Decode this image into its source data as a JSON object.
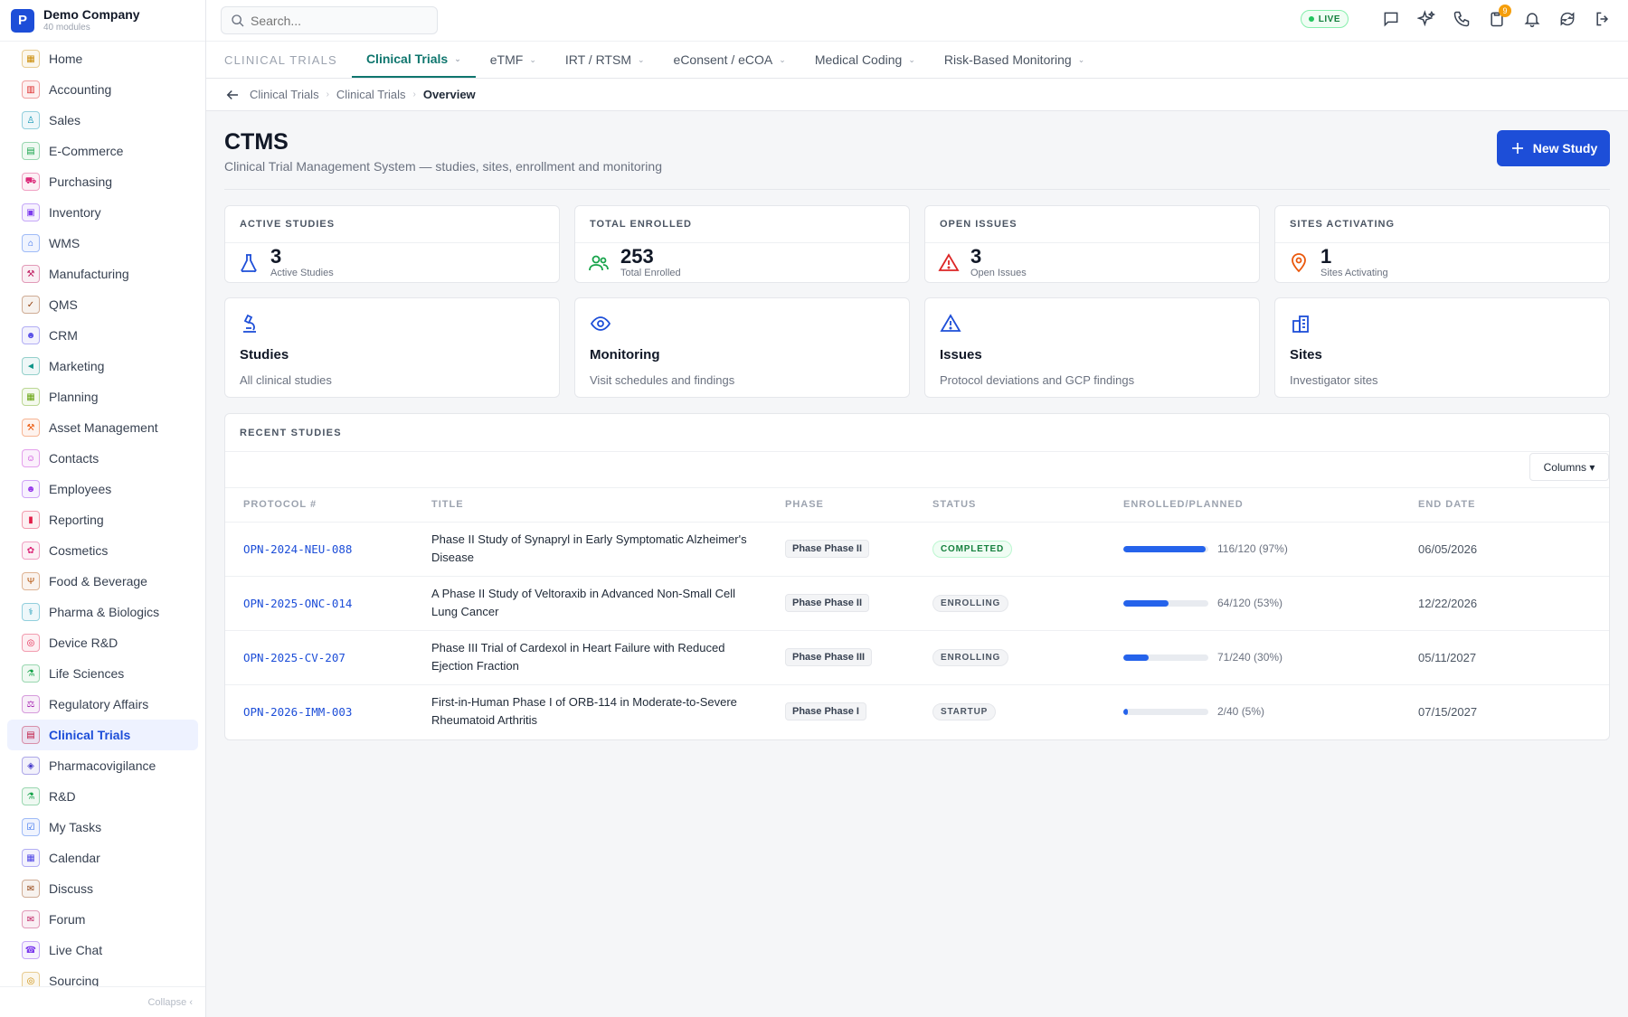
{
  "company": {
    "name": "Demo Company",
    "sub": "40 modules",
    "logo": "P"
  },
  "sidebar": {
    "items": [
      {
        "label": "Home",
        "icon": "grid-icon",
        "glyph": "▦",
        "color": "#ca8a04"
      },
      {
        "label": "Accounting",
        "icon": "bank-icon",
        "glyph": "▥",
        "color": "#dc2626"
      },
      {
        "label": "Sales",
        "icon": "flask-icon",
        "glyph": "♙",
        "color": "#0891b2"
      },
      {
        "label": "E-Commerce",
        "icon": "store-icon",
        "glyph": "▤",
        "color": "#16a34a"
      },
      {
        "label": "Purchasing",
        "icon": "cart-icon",
        "glyph": "⛟",
        "color": "#db2777"
      },
      {
        "label": "Inventory",
        "icon": "box-icon",
        "glyph": "▣",
        "color": "#7c3aed"
      },
      {
        "label": "WMS",
        "icon": "warehouse-icon",
        "glyph": "⌂",
        "color": "#2563eb"
      },
      {
        "label": "Manufacturing",
        "icon": "factory-icon",
        "glyph": "⚒",
        "color": "#be185d"
      },
      {
        "label": "QMS",
        "icon": "badge-check-icon",
        "glyph": "✓",
        "color": "#92400e"
      },
      {
        "label": "CRM",
        "icon": "users-icon",
        "glyph": "☻",
        "color": "#4f46e5"
      },
      {
        "label": "Marketing",
        "icon": "megaphone-icon",
        "glyph": "◄",
        "color": "#0d9488"
      },
      {
        "label": "Planning",
        "icon": "calendar-icon",
        "glyph": "▦",
        "color": "#65a30d"
      },
      {
        "label": "Asset Management",
        "icon": "wrench-icon",
        "glyph": "⚒",
        "color": "#ea580c"
      },
      {
        "label": "Contacts",
        "icon": "contact-icon",
        "glyph": "☺",
        "color": "#c026d3"
      },
      {
        "label": "Employees",
        "icon": "employee-icon",
        "glyph": "☻",
        "color": "#9333ea"
      },
      {
        "label": "Reporting",
        "icon": "bar-chart-icon",
        "glyph": "▮",
        "color": "#e11d48"
      },
      {
        "label": "Cosmetics",
        "icon": "flower-icon",
        "glyph": "✿",
        "color": "#db2777"
      },
      {
        "label": "Food & Beverage",
        "icon": "utensils-icon",
        "glyph": "Ψ",
        "color": "#b45309"
      },
      {
        "label": "Pharma & Biologics",
        "icon": "pill-icon",
        "glyph": "⚕",
        "color": "#0891b2"
      },
      {
        "label": "Device R&D",
        "icon": "chip-icon",
        "glyph": "◎",
        "color": "#e11d48"
      },
      {
        "label": "Life Sciences",
        "icon": "microscope-icon",
        "glyph": "⚗",
        "color": "#16a34a"
      },
      {
        "label": "Regulatory Affairs",
        "icon": "scale-icon",
        "glyph": "⚖",
        "color": "#a21caf"
      },
      {
        "label": "Clinical Trials",
        "icon": "clipboard-icon",
        "glyph": "▤",
        "color": "#be123c",
        "active": true
      },
      {
        "label": "Pharmacovigilance",
        "icon": "shield-icon",
        "glyph": "◈",
        "color": "#4338ca"
      },
      {
        "label": "R&D",
        "icon": "beaker-icon",
        "glyph": "⚗",
        "color": "#16a34a"
      },
      {
        "label": "My Tasks",
        "icon": "checklist-icon",
        "glyph": "☑",
        "color": "#2563eb"
      },
      {
        "label": "Calendar",
        "icon": "calendar-icon",
        "glyph": "▦",
        "color": "#4f46e5"
      },
      {
        "label": "Discuss",
        "icon": "chat-icon",
        "glyph": "✉",
        "color": "#92400e"
      },
      {
        "label": "Forum",
        "icon": "forum-icon",
        "glyph": "✉",
        "color": "#be185d"
      },
      {
        "label": "Live Chat",
        "icon": "headset-icon",
        "glyph": "☎",
        "color": "#7c3aed"
      },
      {
        "label": "Sourcing",
        "icon": "sourcing-icon",
        "glyph": "◎",
        "color": "#ca8a04"
      }
    ],
    "collapse_label": "Collapse ‹"
  },
  "search": {
    "placeholder": "Search..."
  },
  "topbar": {
    "live_label": "LIVE",
    "notif_count": "9"
  },
  "tabs": {
    "module_label": "CLINICAL TRIALS",
    "items": [
      {
        "label": "Clinical Trials",
        "active": true
      },
      {
        "label": "eTMF"
      },
      {
        "label": "IRT / RTSM"
      },
      {
        "label": "eConsent / eCOA"
      },
      {
        "label": "Medical Coding"
      },
      {
        "label": "Risk-Based Monitoring"
      }
    ]
  },
  "breadcrumb": {
    "items": [
      "Clinical Trials",
      "Clinical Trials"
    ],
    "current": "Overview"
  },
  "page": {
    "title": "CTMS",
    "subtitle": "Clinical Trial Management System — studies, sites, enrollment and monitoring",
    "new_button": "New Study"
  },
  "stats": [
    {
      "head": "ACTIVE STUDIES",
      "value": "3",
      "label": "Active Studies",
      "icon": "flask-icon",
      "color": "#1d4ed8"
    },
    {
      "head": "TOTAL ENROLLED",
      "value": "253",
      "label": "Total Enrolled",
      "icon": "users-icon",
      "color": "#16a34a"
    },
    {
      "head": "OPEN ISSUES",
      "value": "3",
      "label": "Open Issues",
      "icon": "alert-triangle-icon",
      "color": "#dc2626"
    },
    {
      "head": "SITES ACTIVATING",
      "value": "1",
      "label": "Sites Activating",
      "icon": "map-pin-icon",
      "color": "#ea580c"
    }
  ],
  "cards": [
    {
      "title": "Studies",
      "desc": "All clinical studies",
      "icon": "microscope-icon"
    },
    {
      "title": "Monitoring",
      "desc": "Visit schedules and findings",
      "icon": "eye-icon"
    },
    {
      "title": "Issues",
      "desc": "Protocol deviations and GCP findings",
      "icon": "alert-triangle-icon"
    },
    {
      "title": "Sites",
      "desc": "Investigator sites",
      "icon": "building-icon"
    }
  ],
  "recent": {
    "heading": "RECENT STUDIES",
    "columns_button": "Columns ▾",
    "headers": [
      "PROTOCOL #",
      "TITLE",
      "PHASE",
      "STATUS",
      "ENROLLED/PLANNED",
      "END DATE"
    ],
    "rows": [
      {
        "protocol": "OPN-2024-NEU-088",
        "title": "Phase II Study of Synapryl in Early Symptomatic Alzheimer's Disease",
        "phase": "Phase Phase II",
        "status": "COMPLETED",
        "status_class": "st-completed",
        "enrolled": "116/120 (97%)",
        "pct": 97,
        "end": "06/05/2026"
      },
      {
        "protocol": "OPN-2025-ONC-014",
        "title": "A Phase II Study of Veltoraxib in Advanced Non-Small Cell Lung Cancer",
        "phase": "Phase Phase II",
        "status": "ENROLLING",
        "status_class": "st-enrolling",
        "enrolled": "64/120 (53%)",
        "pct": 53,
        "end": "12/22/2026"
      },
      {
        "protocol": "OPN-2025-CV-207",
        "title": "Phase III Trial of Cardexol in Heart Failure with Reduced Ejection Fraction",
        "phase": "Phase Phase III",
        "status": "ENROLLING",
        "status_class": "st-enrolling",
        "enrolled": "71/240 (30%)",
        "pct": 30,
        "end": "05/11/2027"
      },
      {
        "protocol": "OPN-2026-IMM-003",
        "title": "First-in-Human Phase I of ORB-114 in Moderate-to-Severe Rheumatoid Arthritis",
        "phase": "Phase Phase I",
        "status": "STARTUP",
        "status_class": "st-startup",
        "enrolled": "2/40 (5%)",
        "pct": 5,
        "end": "07/15/2027"
      }
    ]
  }
}
